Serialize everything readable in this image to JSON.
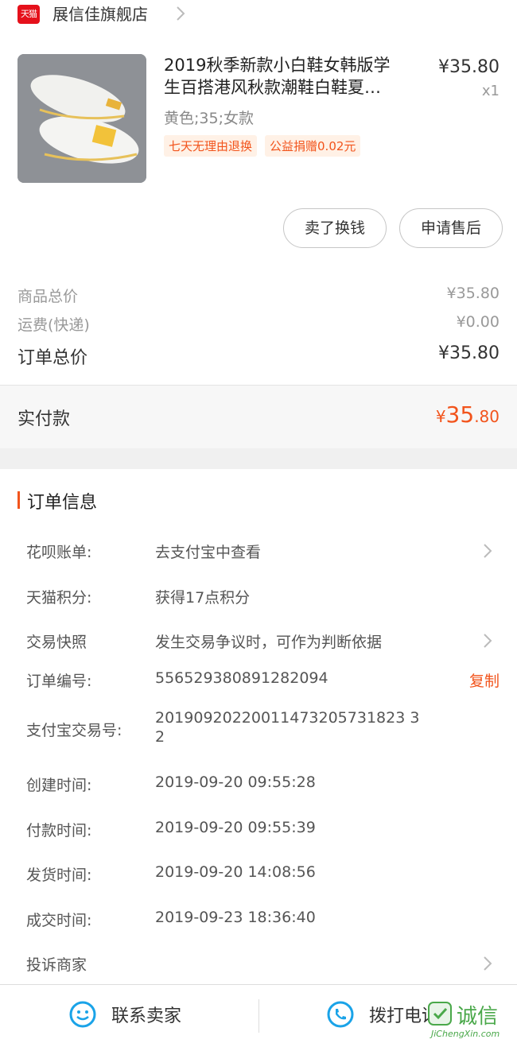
{
  "store": {
    "badge": "天猫",
    "name": "展信佳旗舰店"
  },
  "product": {
    "title_line1": "2019秋季新款小白鞋女韩版学",
    "title_line2": "生百搭港风秋款潮鞋白鞋夏…",
    "price": "¥35.80",
    "qty": "x1",
    "sku": "黄色;35;女款",
    "tags": [
      "七天无理由退换",
      "公益捐赠0.02元"
    ]
  },
  "actions": {
    "sell": "卖了换钱",
    "after_sale": "申请售后"
  },
  "summary": {
    "goods_label": "商品总价",
    "goods_value": "¥35.80",
    "shipping_label": "运费(快递)",
    "shipping_value": "¥0.00",
    "total_label": "订单总价",
    "total_value": "¥35.80"
  },
  "paid": {
    "label": "实付款",
    "currency": "¥",
    "int": "35",
    "dec": ".80"
  },
  "order_info": {
    "title": "订单信息",
    "rows": [
      {
        "key": "花呗账单:",
        "value": "去支付宝中查看"
      },
      {
        "key": "天猫积分:",
        "value": "获得17点积分"
      },
      {
        "key": "交易快照",
        "value": "发生交易争议时，可作为判断依据"
      },
      {
        "key": "订单编号:",
        "value": "556529380891282094",
        "action": "复制"
      },
      {
        "key": "支付宝交易号:",
        "value_line1": "20190920220011473205731823 3",
        "value_line2": "2"
      },
      {
        "key": "创建时间:",
        "value": "2019-09-20 09:55:28"
      },
      {
        "key": "付款时间:",
        "value": "2019-09-20 09:55:39"
      },
      {
        "key": "发货时间:",
        "value": "2019-09-20 14:08:56"
      },
      {
        "key": "成交时间:",
        "value": "2019-09-23 18:36:40"
      },
      {
        "key": "投诉商家",
        "value": ""
      }
    ]
  },
  "bottom": {
    "contact_seller": "联系卖家",
    "call_phone": "拨打电话"
  },
  "watermark": {
    "text": "诚信",
    "site": "JiChengXin.com"
  },
  "colors": {
    "accent": "#f2541c",
    "tmall_red": "#e5111b",
    "icon_blue": "#1aa3e8"
  }
}
